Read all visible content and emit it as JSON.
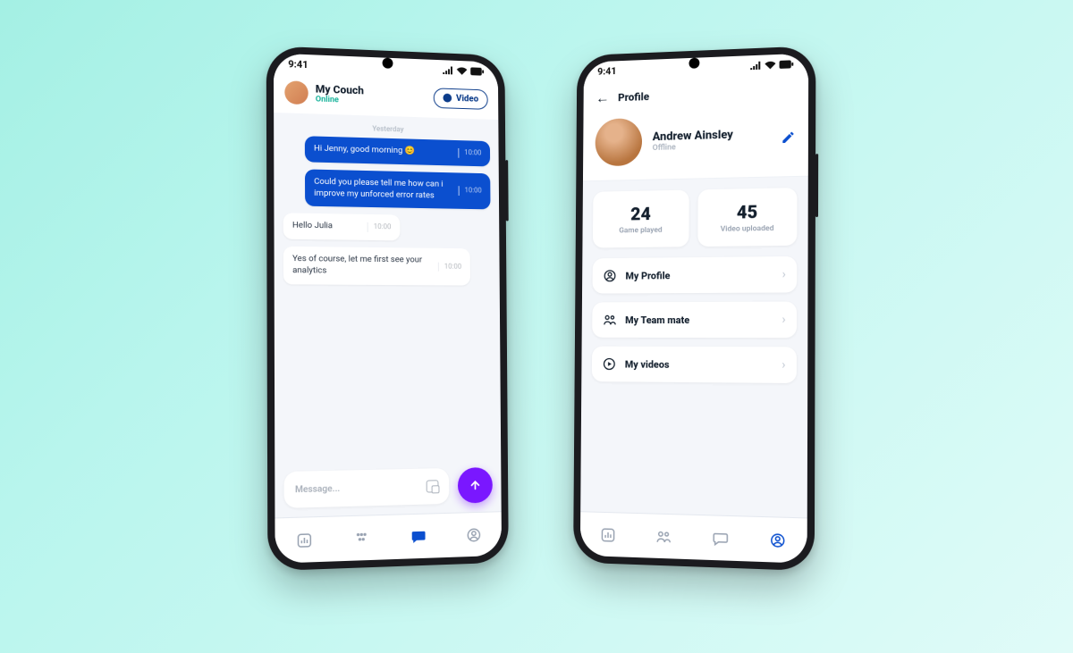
{
  "status_time": "9:41",
  "chat": {
    "name": "My Couch",
    "status": "Online",
    "video_label": "Video",
    "separator": "Yesterday",
    "messages": [
      {
        "side": "me",
        "text": "Hi Jenny, good morning 😊",
        "time": "10:00"
      },
      {
        "side": "me",
        "text": "Could you please tell me how can i improve my unforced error rates",
        "time": "10:00"
      },
      {
        "side": "them",
        "text": "Hello Julia",
        "time": "10:00"
      },
      {
        "side": "them",
        "text": "Yes of course, let me first see your analytics",
        "time": "10:00"
      }
    ],
    "composer_placeholder": "Message..."
  },
  "profile": {
    "header": "Profile",
    "name": "Andrew Ainsley",
    "status": "Offline",
    "stats": [
      {
        "value": "24",
        "label": "Game played"
      },
      {
        "value": "45",
        "label": "Video uploaded"
      }
    ],
    "menu": [
      {
        "icon": "user",
        "label": "My Profile"
      },
      {
        "icon": "team",
        "label": "My Team mate"
      },
      {
        "icon": "video",
        "label": "My videos"
      }
    ]
  }
}
